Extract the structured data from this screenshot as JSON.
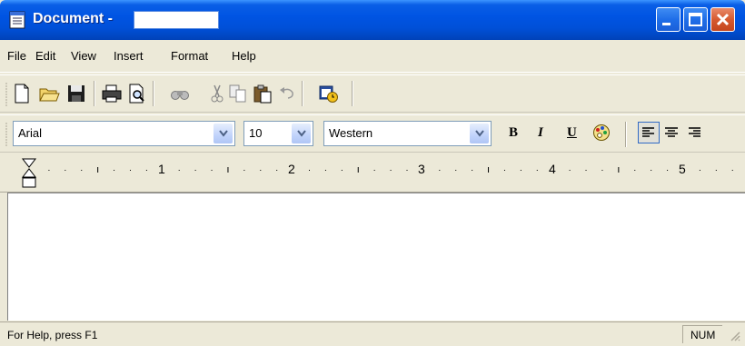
{
  "window": {
    "title": "Document -",
    "title_field_value": ""
  },
  "menubar": {
    "items": [
      "File",
      "Edit",
      "View",
      "Insert",
      "Format",
      "Help"
    ]
  },
  "toolbar": {
    "icons": [
      "new-icon",
      "open-icon",
      "save-icon",
      "print-icon",
      "print-preview-icon",
      "find-icon",
      "cut-icon",
      "copy-icon",
      "paste-icon",
      "undo-icon",
      "insert-date-time-icon"
    ]
  },
  "format_bar": {
    "font": "Arial",
    "size": "10",
    "script": "Western",
    "bold_label": "B",
    "italic_label": "I",
    "underline_label": "U"
  },
  "ruler": {
    "marks": [
      "1",
      "2",
      "3",
      "4",
      "5"
    ]
  },
  "status": {
    "help_text": "For Help, press F1",
    "num_indicator": "NUM"
  },
  "colors": {
    "title_bar": "#0054e3",
    "close_button": "#d65a30",
    "chrome": "#ece9d8"
  }
}
